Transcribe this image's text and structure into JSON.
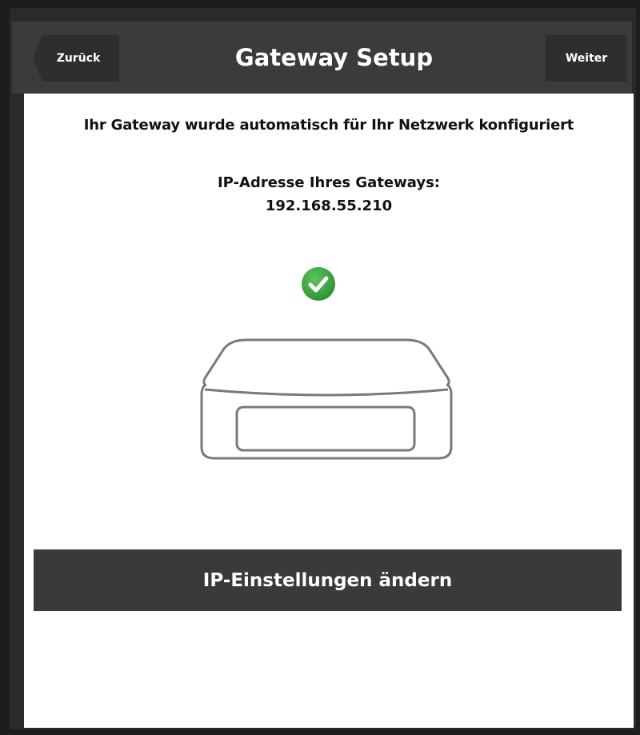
{
  "header": {
    "back_label": "Zurück",
    "title": "Gateway Setup",
    "next_label": "Weiter"
  },
  "main": {
    "status_text": "Ihr Gateway wurde automatisch für Ihr Netzwerk konfiguriert",
    "ip_label": "IP-Adresse Ihres Gateways:",
    "ip_value": "192.168.55.210",
    "status_icon": "check-circle-icon",
    "status_color": "#3aa53f",
    "device_icon": "gateway-device-icon",
    "ip_settings_label": "IP-Einstellungen ändern"
  },
  "colors": {
    "header_bg": "#3b3b3b",
    "button_bg": "#3a3a3a",
    "content_bg": "#ffffff",
    "frame_bg": "#1d1d1d"
  }
}
